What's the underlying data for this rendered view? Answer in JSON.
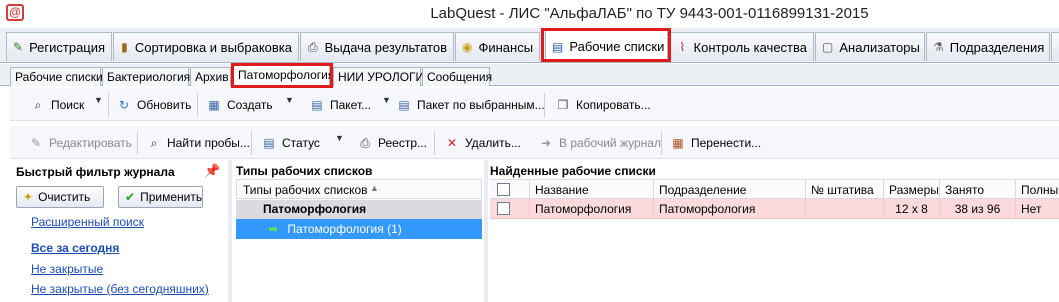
{
  "window": {
    "title": "LabQuest - ЛИС \"АльфаЛАБ\" по ТУ 9443-001-0116899131-2015",
    "app_icon": "at-sign-logo"
  },
  "main_tabs": [
    {
      "label": "Регистрация",
      "icon": "pencil-doc-icon"
    },
    {
      "label": "Сортировка и выбраковка",
      "icon": "book-icon"
    },
    {
      "label": "Выдача результатов",
      "icon": "printer-icon"
    },
    {
      "label": "Финансы",
      "icon": "coins-icon"
    },
    {
      "label": "Рабочие списки",
      "icon": "list-doc-icon",
      "active": true
    },
    {
      "label": "Контроль качества",
      "icon": "chart-icon"
    },
    {
      "label": "Анализаторы",
      "icon": "analyzer-icon"
    },
    {
      "label": "Подразделения",
      "icon": "flask-icon"
    }
  ],
  "sub_tabs": [
    {
      "label": "Рабочие списки"
    },
    {
      "label": "Бактериология"
    },
    {
      "label": "Архив"
    },
    {
      "label": "Патоморфология",
      "active": true
    },
    {
      "label": "НИИ УРОЛОГИИ"
    },
    {
      "label": "Сообщения"
    }
  ],
  "toolbar1": {
    "search": "Поиск",
    "refresh": "Обновить",
    "create": "Создать",
    "package": "Пакет...",
    "package_selected": "Пакет по выбранным...",
    "copy": "Копировать..."
  },
  "toolbar2": {
    "edit": "Редактировать",
    "find_samples": "Найти пробы...",
    "status": "Статус",
    "registry": "Реестр...",
    "delete": "Удалить...",
    "to_journal": "В рабочий журнал",
    "move": "Перенести..."
  },
  "quick_filter": {
    "title": "Быстрый фильтр журнала",
    "clear": "Очистить",
    "apply": "Применить",
    "advanced": "Расширенный поиск",
    "links": [
      "Все за сегодня",
      "Не закрытые",
      "Не закрытые (без сегодняшних)"
    ]
  },
  "list_types": {
    "title": "Типы рабочих списков",
    "header": "Типы рабочих списков",
    "group": "Патоморфология",
    "item": "Патоморфология (1)"
  },
  "found_lists": {
    "title": "Найденные рабочие списки",
    "columns": [
      "Название",
      "Подразделение",
      "№ штатива",
      "Размеры",
      "Занято",
      "Полный"
    ],
    "rows": [
      {
        "name": "Патоморфология",
        "department": "Патоморфология",
        "rack": "",
        "size": "12 x 8",
        "occupied": "38 из 96",
        "full": "Нет"
      }
    ]
  },
  "colors": {
    "highlight_box": "#e01b1b",
    "selection": "#3399ff",
    "row_pink": "#fadadd",
    "link": "#1a4db3"
  }
}
